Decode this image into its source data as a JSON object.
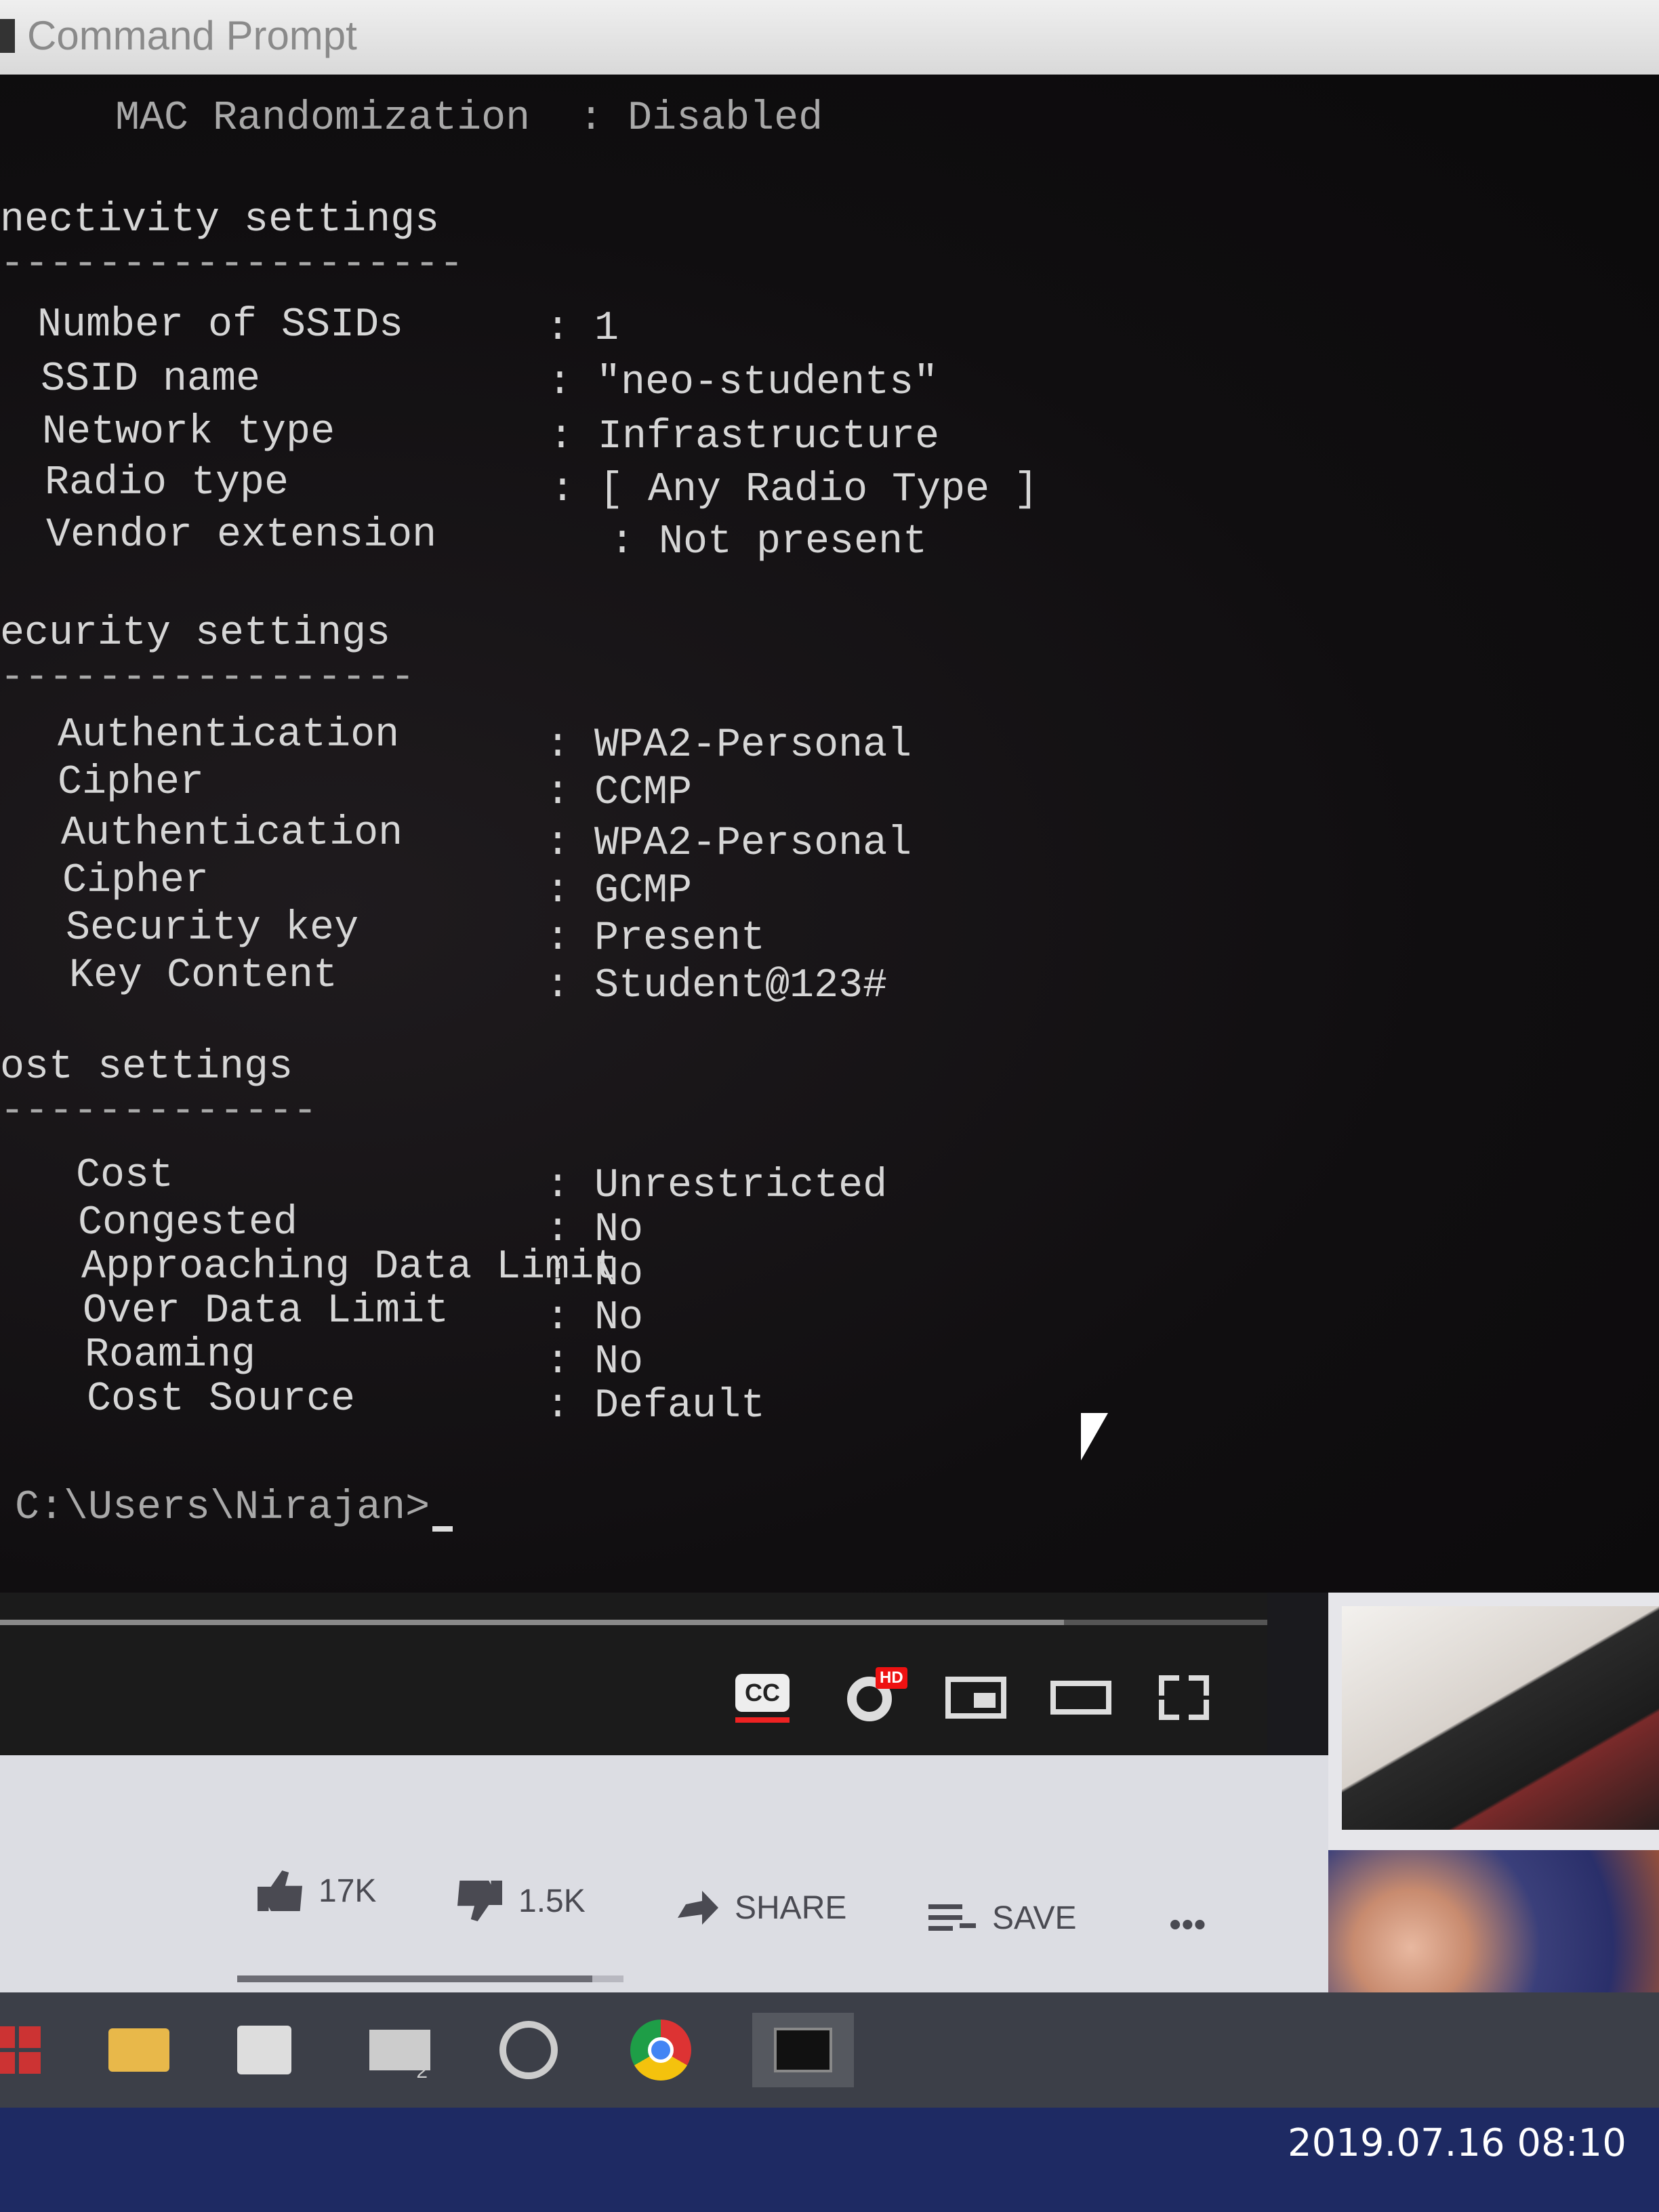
{
  "window": {
    "title": "Command Prompt"
  },
  "console": {
    "lines": [
      {
        "label": "MAC Randomization  ",
        "value": ": Disabled"
      },
      {
        "heading": "nectivity settings",
        "rule": "-------------------"
      },
      {
        "label": "Number of SSIDs",
        "value": ": 1"
      },
      {
        "label": "SSID name",
        "value": ": \"neo-students\""
      },
      {
        "label": "Network type",
        "value": ": Infrastructure"
      },
      {
        "label": "Radio type",
        "value": ": [ Any Radio Type ]"
      },
      {
        "label": "Vendor extension",
        "value": ": Not present"
      },
      {
        "heading": "ecurity settings",
        "rule": "-----------------"
      },
      {
        "label": "Authentication",
        "value": ": WPA2-Personal"
      },
      {
        "label": "Cipher",
        "value": ": CCMP"
      },
      {
        "label": "Authentication",
        "value": ": WPA2-Personal"
      },
      {
        "label": "Cipher",
        "value": ": GCMP"
      },
      {
        "label": "Security key",
        "value": ": Present"
      },
      {
        "label": "Key Content",
        "value": ": Student@123#"
      },
      {
        "heading": "ost settings",
        "rule": "-------------"
      },
      {
        "label": "Cost",
        "value": ": Unrestricted"
      },
      {
        "label": "Congested",
        "value": ": No"
      },
      {
        "label": "Approaching Data Limit",
        "value": ": No"
      },
      {
        "label": "Over Data Limit",
        "value": ": No"
      },
      {
        "label": "Roaming",
        "value": ": No"
      },
      {
        "label": "Cost Source",
        "value": ": Default"
      }
    ],
    "prompt": "C:\\Users\\Nirajan>"
  },
  "player": {
    "cc_label": "CC",
    "hd_badge": "HD",
    "icons": [
      "cc-icon",
      "settings-gear-icon",
      "miniplayer-icon",
      "theater-mode-icon",
      "fullscreen-icon"
    ]
  },
  "actions": {
    "like_count": "17K",
    "dislike_count": "1.5K",
    "share_label": "SHARE",
    "save_label": "SAVE",
    "more_label": "•••",
    "like_ratio": 0.92
  },
  "taskbar": {
    "items": [
      "start-icon",
      "file-explorer-icon",
      "store-icon",
      "mail-icon",
      "groove-music-icon",
      "chrome-icon",
      "command-prompt-icon"
    ],
    "mail_badge": "2"
  },
  "photo_timestamp": "2019.07.16 08:10",
  "colors": {
    "console_bg": "#0e0c0e",
    "console_text": "#d6d6d6",
    "taskbar": "#1e2a63",
    "cc_underline": "#e22222"
  }
}
